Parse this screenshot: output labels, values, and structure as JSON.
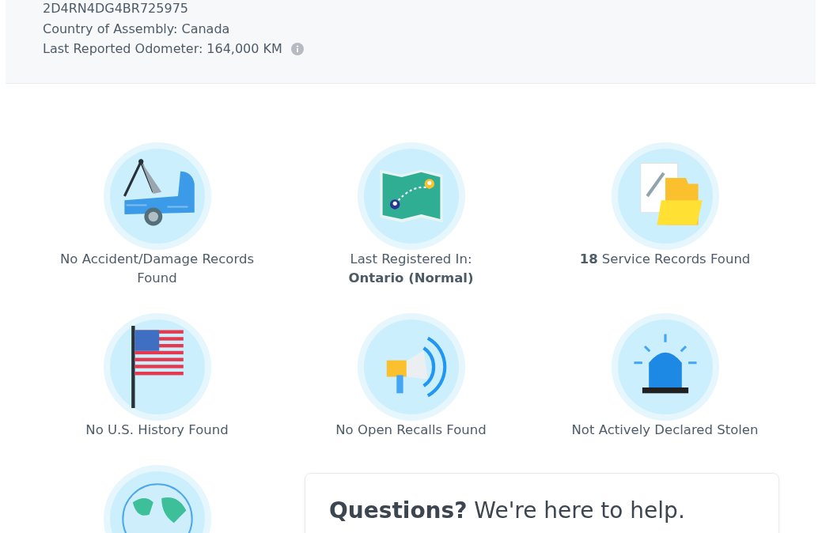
{
  "vehicle": {
    "vin": "2D4RN4DG4BR725975",
    "details": [
      {
        "label": "Country of Assembly:",
        "value": "Canada",
        "info": false
      },
      {
        "label": "Last Reported Odometer:",
        "value": "164,000 KM",
        "info": true
      }
    ]
  },
  "summary": [
    {
      "kind": "towtruck",
      "text": "No Accident/Damage Records Found"
    },
    {
      "kind": "map",
      "text": "Last Registered In:\n**Ontario (Normal)**"
    },
    {
      "kind": "folder",
      "text": "**18** Service Records Found"
    },
    {
      "kind": "flag",
      "text": "No U.S. History Found"
    },
    {
      "kind": "megaphone",
      "text": "No Open Recalls Found"
    },
    {
      "kind": "siren",
      "text": "Not Actively Declared Stolen"
    },
    {
      "kind": "globe"
    }
  ],
  "help": {
    "title": "**Questions?** We're here to help."
  }
}
